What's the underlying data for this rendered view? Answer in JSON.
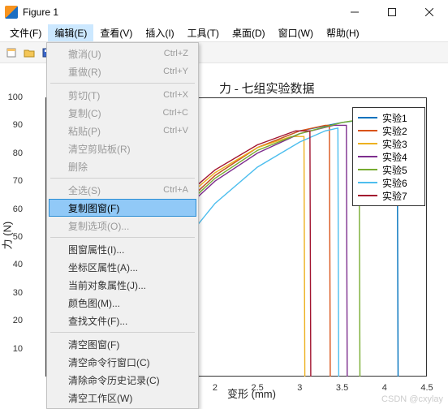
{
  "window": {
    "title": "Figure 1"
  },
  "menubar": {
    "items": [
      {
        "label": "文件(F)"
      },
      {
        "label": "编辑(E)"
      },
      {
        "label": "查看(V)"
      },
      {
        "label": "插入(I)"
      },
      {
        "label": "工具(T)"
      },
      {
        "label": "桌面(D)"
      },
      {
        "label": "窗口(W)"
      },
      {
        "label": "帮助(H)"
      }
    ],
    "active_index": 1
  },
  "edit_menu": {
    "items": [
      {
        "label": "撤消(U)",
        "shortcut": "Ctrl+Z",
        "disabled": true
      },
      {
        "label": "重做(R)",
        "shortcut": "Ctrl+Y",
        "disabled": true
      },
      {
        "sep": true
      },
      {
        "label": "剪切(T)",
        "shortcut": "Ctrl+X",
        "disabled": true
      },
      {
        "label": "复制(C)",
        "shortcut": "Ctrl+C",
        "disabled": true
      },
      {
        "label": "粘贴(P)",
        "shortcut": "Ctrl+V",
        "disabled": true
      },
      {
        "label": "清空剪贴板(R)",
        "shortcut": "",
        "disabled": true
      },
      {
        "label": "删除",
        "shortcut": "",
        "disabled": true
      },
      {
        "sep": true
      },
      {
        "label": "全选(S)",
        "shortcut": "Ctrl+A",
        "disabled": true
      },
      {
        "label": "复制图窗(F)",
        "shortcut": "",
        "disabled": false,
        "highlight": true
      },
      {
        "label": "复制选项(O)...",
        "shortcut": "",
        "disabled": true
      },
      {
        "sep": true
      },
      {
        "label": "图窗属性(I)...",
        "shortcut": "",
        "disabled": false
      },
      {
        "label": "坐标区属性(A)...",
        "shortcut": "",
        "disabled": false
      },
      {
        "label": "当前对象属性(J)...",
        "shortcut": "",
        "disabled": false
      },
      {
        "label": "颜色图(M)...",
        "shortcut": "",
        "disabled": false
      },
      {
        "label": "查找文件(F)...",
        "shortcut": "",
        "disabled": false
      },
      {
        "sep": true
      },
      {
        "label": "清空图窗(F)",
        "shortcut": "",
        "disabled": false
      },
      {
        "label": "清空命令行窗口(C)",
        "shortcut": "",
        "disabled": false
      },
      {
        "label": "清除命令历史记录(C)",
        "shortcut": "",
        "disabled": false
      },
      {
        "label": "清空工作区(W)",
        "shortcut": "",
        "disabled": false
      }
    ]
  },
  "chart_data": {
    "type": "line",
    "title_fragment": "力 - 七组实验数据",
    "xlabel": "变形 (mm)",
    "ylabel": "力 (N)",
    "xlim": [
      0,
      4.5
    ],
    "ylim": [
      0,
      100
    ],
    "x_ticks": [
      2,
      2.5,
      3,
      3.5,
      4,
      4.5
    ],
    "y_ticks": [
      10,
      20,
      30,
      40,
      50,
      60,
      70,
      80,
      90,
      100
    ],
    "legend": [
      "实验1",
      "实验2",
      "实验3",
      "实验4",
      "实验5",
      "实验6",
      "实验7"
    ],
    "colors": [
      "#0072BD",
      "#D95319",
      "#EDB120",
      "#7E2F8E",
      "#77AC30",
      "#4DBEEE",
      "#A2142F"
    ],
    "series": [
      {
        "name": "实验1",
        "x": [
          0.5,
          1.0,
          1.5,
          2.0,
          2.5,
          3.0,
          3.5,
          4.0,
          4.15,
          4.16
        ],
        "y": [
          20,
          40,
          58,
          72,
          82,
          88,
          91,
          93,
          93,
          0
        ]
      },
      {
        "name": "实验2",
        "x": [
          0.5,
          1.0,
          1.5,
          2.0,
          2.5,
          3.0,
          3.3,
          3.35,
          3.36
        ],
        "y": [
          20,
          40,
          58,
          72,
          82,
          88,
          90,
          90,
          0
        ]
      },
      {
        "name": "实验3",
        "x": [
          0.5,
          1.0,
          1.5,
          2.0,
          2.5,
          2.9,
          3.05,
          3.06
        ],
        "y": [
          22,
          42,
          60,
          73,
          82,
          86,
          86,
          0
        ]
      },
      {
        "name": "实验4",
        "x": [
          0.5,
          1.0,
          1.5,
          2.0,
          2.5,
          3.0,
          3.4,
          3.55,
          3.56
        ],
        "y": [
          18,
          38,
          56,
          70,
          80,
          87,
          90,
          90,
          0
        ]
      },
      {
        "name": "实验5",
        "x": [
          0.5,
          1.0,
          1.5,
          2.0,
          2.5,
          3.0,
          3.5,
          3.7,
          3.71
        ],
        "y": [
          19,
          39,
          57,
          71,
          81,
          87,
          91,
          92,
          0
        ]
      },
      {
        "name": "实验6",
        "x": [
          0.8,
          1.2,
          1.6,
          2.0,
          2.5,
          3.0,
          3.3,
          3.45,
          3.46
        ],
        "y": [
          15,
          30,
          47,
          62,
          75,
          84,
          88,
          89,
          0
        ]
      },
      {
        "name": "实验7",
        "x": [
          0.5,
          1.0,
          1.5,
          2.0,
          2.5,
          2.95,
          3.12,
          3.13
        ],
        "y": [
          23,
          44,
          61,
          74,
          83,
          88,
          88,
          0
        ]
      }
    ]
  },
  "watermark": "CSDN @cxylay"
}
